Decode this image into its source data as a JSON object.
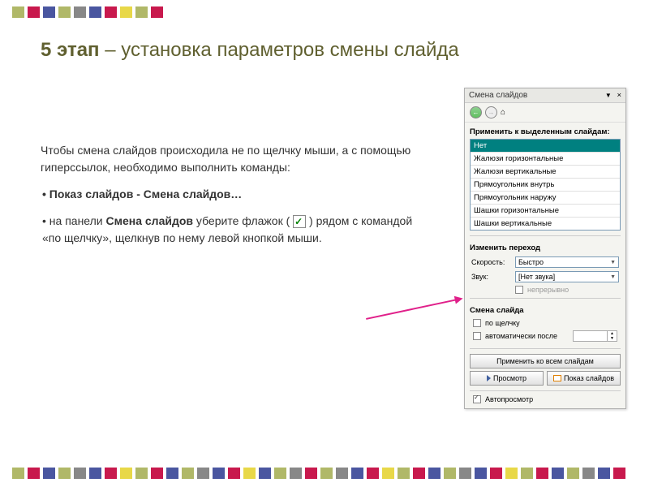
{
  "title": {
    "bold": "5 этап",
    "rest": " – установка параметров смены слайда"
  },
  "content": {
    "p1": "Чтобы смена слайдов происходила не по щелчку мыши, а с помощью гиперссылок, необходимо выполнить команды:",
    "b1": "• Показ слайдов - Смена слайдов…",
    "p2a": "• на панели ",
    "p2b": "Смена слайдов",
    "p2c": " уберите флажок (",
    "p2d": ") рядом с командой «по щелчку», щелкнув по нему левой кнопкой мыши."
  },
  "panel": {
    "title": "Смена слайдов",
    "apply_label": "Применить к выделенным слайдам:",
    "transitions": [
      "Нет",
      "Жалюзи горизонтальные",
      "Жалюзи вертикальные",
      "Прямоугольник внутрь",
      "Прямоугольник наружу",
      "Шашки горизонтальные",
      "Шашки вертикальные"
    ],
    "modify_label": "Изменить переход",
    "speed_label": "Скорость:",
    "speed_value": "Быстро",
    "sound_label": "Звук:",
    "sound_value": "[Нет звука]",
    "continuous": "непрерывно",
    "advance_label": "Смена слайда",
    "on_click": "по щелчку",
    "auto_after": "автоматически после",
    "apply_all": "Применить ко всем слайдам",
    "preview": "Просмотр",
    "slideshow": "Показ слайдов",
    "autopreview": "Автопросмотр"
  }
}
